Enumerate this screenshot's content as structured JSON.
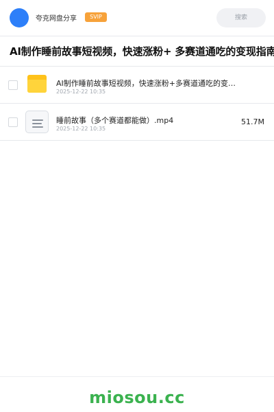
{
  "header": {
    "username": "夸克网盘分享",
    "badge": "SVIP",
    "search_placeholder": "搜索"
  },
  "page_title": "AI制作睡前故事短视频，快速涨粉+ 多赛道通吃的变现指南",
  "files": [
    {
      "type": "folder",
      "name": "AI制作睡前故事短视频，快速涨粉+多赛道通吃的变现指南",
      "date": "2025-12-22 10:35",
      "size": ""
    },
    {
      "type": "file",
      "name": "睡前故事（多个赛道都能做）.mp4",
      "date": "2025-12-22 10:35",
      "size": "51.7M"
    }
  ],
  "footer": {
    "brand": "miosou.cc"
  },
  "colors": {
    "avatar": "#2d7ff9",
    "badge": "#f7a23a",
    "folder": "#ffc21a",
    "brand": "#3bb24f"
  }
}
